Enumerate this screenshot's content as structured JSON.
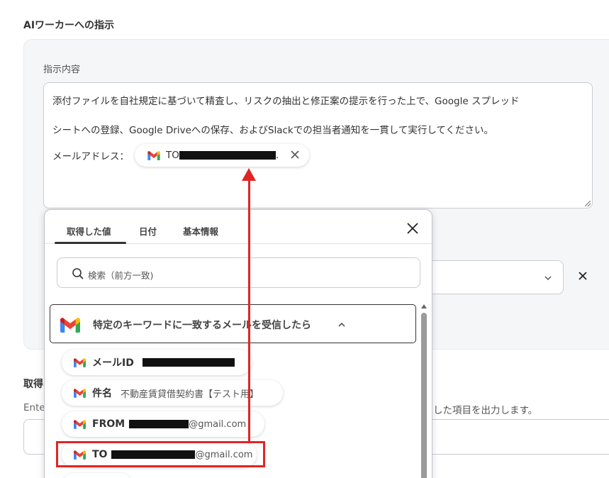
{
  "section": {
    "title": "AIワーカーへの指示"
  },
  "instruction": {
    "field_label": "指示内容",
    "line1": "添付ファイルを自社規定に基づいて精査し、リスクの抽出と修正案の提示を行った上で、Google スプレッド",
    "line2": "シートへの登録、Google Driveへの保存、およびSlackでの担当者通知を一貫して実行してください。",
    "mail_label": "メールアドレス：",
    "chip": {
      "prefix": "TO",
      "suffix": "."
    }
  },
  "dropdown": {
    "tabs": [
      {
        "label": "取得した値",
        "active": true
      },
      {
        "label": "日付",
        "active": false
      },
      {
        "label": "基本情報",
        "active": false
      }
    ],
    "search_placeholder": "検索（前方一致)",
    "group": {
      "label": "特定のキーワードに一致するメールを受信したら"
    },
    "items": [
      {
        "label": "メールID",
        "value": ""
      },
      {
        "label": "件名",
        "value": "不動産賃貸借契約書【テスト用】"
      },
      {
        "label": "FROM",
        "value": "@gmail.com"
      },
      {
        "label": "TO",
        "value": "@gmail.com"
      }
    ]
  },
  "background": {
    "acquire_label": "取得",
    "enter_text": "Ente",
    "output_text": "した項目を出力します。"
  },
  "colors": {
    "annotation": "#e02525",
    "gmail_red": "#ea4335",
    "gmail_blue": "#4285f4",
    "gmail_green": "#34a853",
    "gmail_yellow": "#fbbc05"
  },
  "icons": [
    "gmail-icon",
    "close-icon",
    "search-icon",
    "chevron-up-icon",
    "chevron-down-icon"
  ]
}
